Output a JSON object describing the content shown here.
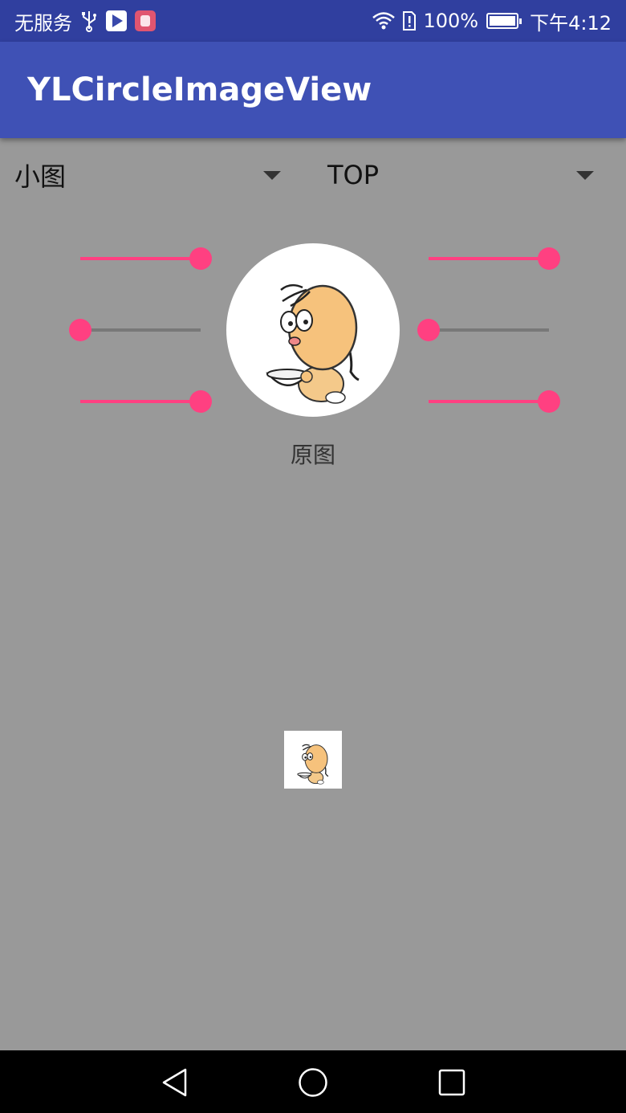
{
  "status_bar": {
    "carrier": "无服务",
    "battery": "100%",
    "battery_level": 1.0,
    "time": "下午4:12",
    "icons": [
      "usb-icon",
      "video-app-icon",
      "app-icon",
      "wifi-icon",
      "sim-alert-icon",
      "battery-icon"
    ]
  },
  "toolbar": {
    "title": "YLCircleImageView"
  },
  "spinners": {
    "image_size": {
      "value": "小图"
    },
    "scale_type": {
      "value": "TOP"
    }
  },
  "sliders": {
    "left_top": {
      "value": 1.0
    },
    "left_middle": {
      "value": 0.0
    },
    "left_bottom": {
      "value": 1.0
    },
    "right_top": {
      "value": 1.0
    },
    "right_middle": {
      "value": 0.0
    },
    "right_bottom": {
      "value": 1.0
    }
  },
  "preview": {
    "caption": "原图"
  },
  "colors": {
    "status_bar": "#303F9F",
    "toolbar": "#3F51B5",
    "accent": "#FF4081",
    "background": "#999999"
  },
  "nav_bar": {
    "icons": [
      "back-icon",
      "home-icon",
      "recents-icon"
    ]
  }
}
